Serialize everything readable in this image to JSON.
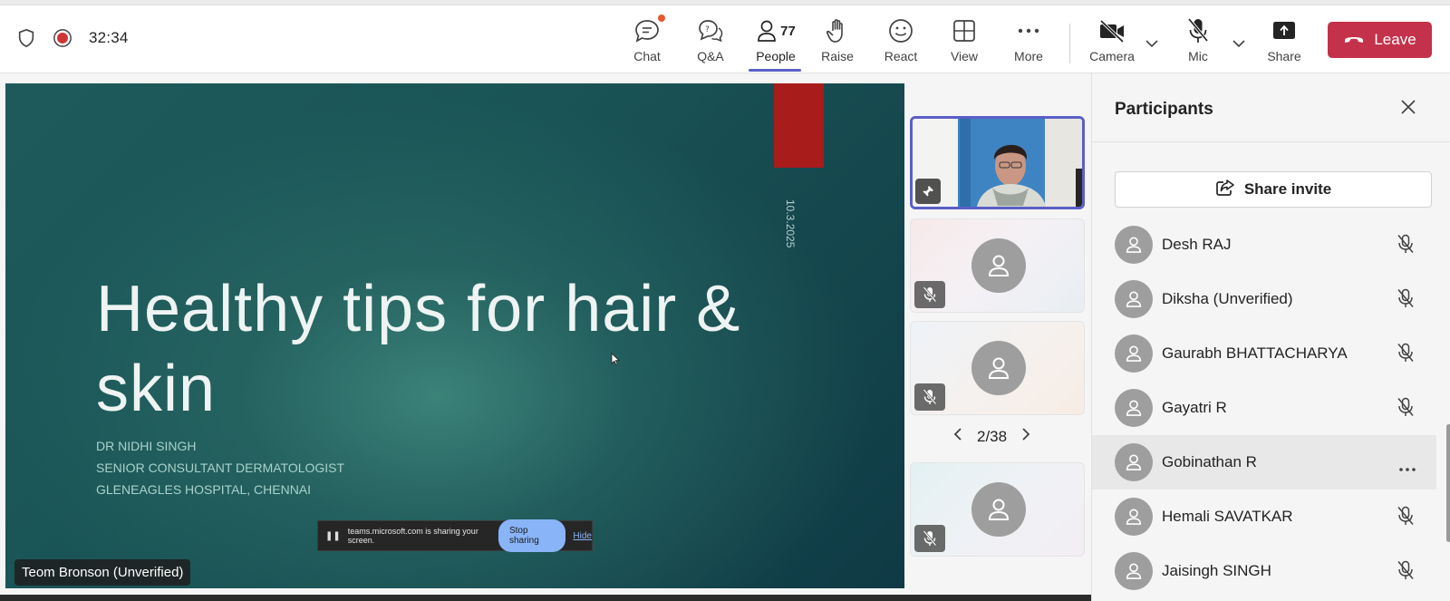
{
  "meeting": {
    "timer": "32:34"
  },
  "toolbar": {
    "chat_label": "Chat",
    "qa_label": "Q&A",
    "people_label": "People",
    "people_count": "77",
    "raise_label": "Raise",
    "react_label": "React",
    "view_label": "View",
    "more_label": "More",
    "camera_label": "Camera",
    "mic_label": "Mic",
    "share_label": "Share",
    "leave_label": "Leave"
  },
  "slide": {
    "date": "10.3.2025",
    "title": "Healthy tips for hair & skin",
    "subtitle_lines": [
      "DR NIDHI SINGH",
      "SENIOR CONSULTANT DERMATOLOGIST",
      "GLENEAGLES HOSPITAL, CHENNAI"
    ]
  },
  "share_bar": {
    "message": "teams.microsoft.com is sharing your screen.",
    "stop_label": "Stop sharing",
    "hide_label": "Hide"
  },
  "presenter": {
    "name": "Teom Bronson (Unverified)"
  },
  "gallery": {
    "page": "2/38"
  },
  "participants_panel": {
    "title": "Participants",
    "share_invite_label": "Share invite",
    "people": [
      {
        "name": "Desh RAJ",
        "state": "muted"
      },
      {
        "name": "Diksha (Unverified)",
        "state": "muted"
      },
      {
        "name": "Gaurabh BHATTACHARYA",
        "state": "muted"
      },
      {
        "name": "Gayatri R",
        "state": "muted"
      },
      {
        "name": "Gobinathan R",
        "state": "more"
      },
      {
        "name": "Hemali SAVATKAR",
        "state": "muted"
      },
      {
        "name": "Jaisingh SINGH",
        "state": "muted"
      }
    ]
  },
  "colors": {
    "accent": "#5b5fc7",
    "leave": "#c4314b",
    "slide_accent": "#a81c1c"
  },
  "icons": [
    "shield-icon",
    "record-icon",
    "chat-icon",
    "qa-icon",
    "people-icon",
    "raise-hand-icon",
    "react-icon",
    "view-icon",
    "more-icon",
    "camera-off-icon",
    "mic-off-icon",
    "share-icon",
    "phone-icon",
    "close-icon",
    "share-invite-icon",
    "person-icon",
    "mic-off-icon",
    "more-horizontal-icon",
    "pin-icon",
    "chevron-left-icon",
    "chevron-right-icon"
  ]
}
